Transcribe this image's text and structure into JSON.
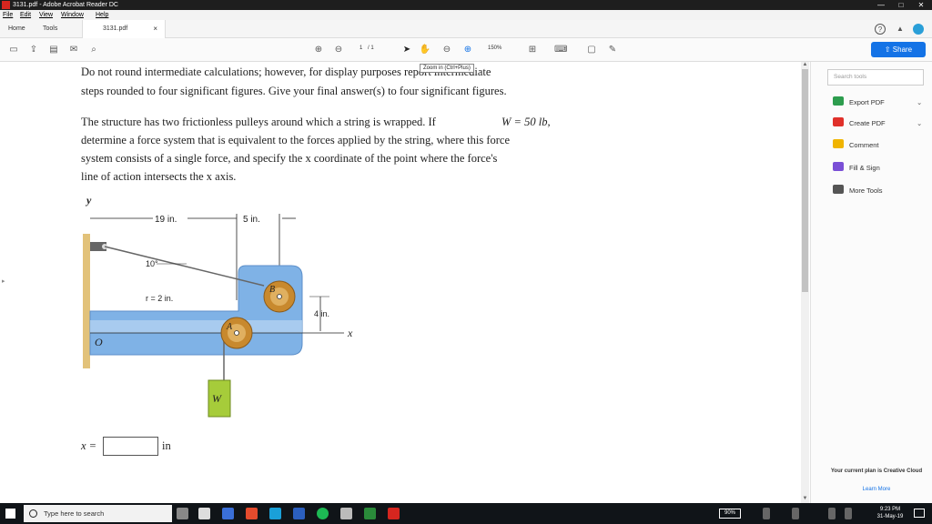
{
  "window": {
    "title": "3131.pdf - Adobe Acrobat Reader DC",
    "controls": [
      "—",
      "□",
      "✕"
    ]
  },
  "menu": [
    "File",
    "Edit",
    "View",
    "Window",
    "Help"
  ],
  "tabs": {
    "home": "Home",
    "tools": "Tools",
    "document": "3131.pdf",
    "close": "×"
  },
  "toolbar": {
    "page_current": "1",
    "page_total": "/ 1",
    "zoom": "150%",
    "share": "Share"
  },
  "tooltip": "Zoom in (Ctrl+Plus)",
  "problem": {
    "line1": "Do not round intermediate calculations; however, for display purposes report intermediate",
    "line2": "steps rounded to four significant figures. Give your final answer(s) to four significant figures.",
    "p2_line1a": "The structure has two frictionless pulleys around which a string is wrapped. If",
    "p2_line1b": "W = 50 lb,",
    "p2_line2": "determine a force system that is equivalent to the forces applied by the string, where this force",
    "p2_line3": "system consists of a single force, and specify the  x  coordinate of the point where the force's",
    "p2_line4": "line of action intersects the  x  axis."
  },
  "figure": {
    "y_axis": "y",
    "x_axis": "x",
    "origin": "O",
    "dim_19": "19 in.",
    "dim_5": "5 in.",
    "angle": "10°",
    "radius": "r = 2 in.",
    "dim_4": "4 in.",
    "pulley_a": "A",
    "pulley_b": "B",
    "weight": "W"
  },
  "answer": {
    "label": "x =",
    "unit": "in",
    "value": ""
  },
  "side_panel": {
    "search_placeholder": "Search tools",
    "tools": [
      {
        "label": "Export PDF",
        "color": "#2d9d4e",
        "chevron": true
      },
      {
        "label": "Create PDF",
        "color": "#e0302a",
        "chevron": true
      },
      {
        "label": "Comment",
        "color": "#f0b400",
        "chevron": false
      },
      {
        "label": "Fill & Sign",
        "color": "#7a4fd6",
        "chevron": false
      },
      {
        "label": "More Tools",
        "color": "#555555",
        "chevron": false
      }
    ],
    "cc_text": "Your current plan is Creative Cloud",
    "learn_more": "Learn More"
  },
  "taskbar": {
    "search_placeholder": "Type here to search",
    "battery": "90%",
    "time": "9:23 PM",
    "date": "31-May-19"
  }
}
